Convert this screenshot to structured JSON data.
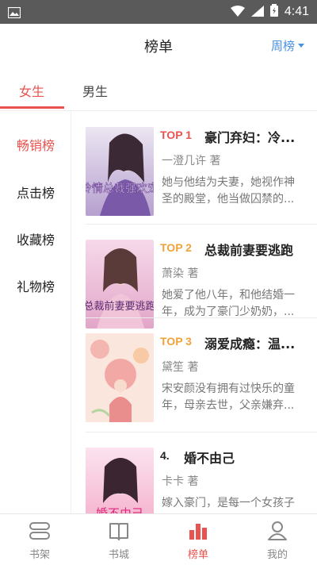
{
  "status_bar": {
    "time": "4:41"
  },
  "header": {
    "title": "榜单",
    "period_selector": "周榜"
  },
  "gender_tabs": [
    {
      "label": "女生",
      "active": true
    },
    {
      "label": "男生",
      "active": false
    }
  ],
  "sidebar": {
    "items": [
      {
        "label": "畅销榜",
        "active": true
      },
      {
        "label": "点击榜",
        "active": false
      },
      {
        "label": "收藏榜",
        "active": false
      },
      {
        "label": "礼物榜",
        "active": false
      }
    ]
  },
  "books": [
    {
      "rank": "TOP 1",
      "title": "豪门弃妇：冷...",
      "author": "一澄几许 著",
      "description": "她与他结为夫妻，她视作神圣的殿堂，他当做囚禁的...",
      "cover_text": "冷情总裁强欢宠"
    },
    {
      "rank": "TOP 2",
      "title": "总裁前妻要逃跑",
      "author": "萧染 著",
      "description": "她爱了他八年，和他结婚一年，成为了豪门少奶奶，...",
      "cover_text": "总裁前妻要逃跑"
    },
    {
      "rank": "TOP 3",
      "title": "溺爱成瘾：温...",
      "author": "黛笙 著",
      "description": "宋安颜没有拥有过快乐的童年，母亲去世，父亲嫌弃...",
      "cover_text": ""
    },
    {
      "rank": "4.",
      "title": "婚不由己",
      "author": "卡卡 著",
      "description": "嫁入豪门，是每一个女孩子的梦想，而对于...",
      "cover_text": "婚不由己"
    }
  ],
  "bottom_nav": [
    {
      "label": "书架",
      "icon": "bookshelf-icon",
      "active": false
    },
    {
      "label": "书城",
      "icon": "book-store-icon",
      "active": false
    },
    {
      "label": "榜单",
      "icon": "ranking-icon",
      "active": true
    },
    {
      "label": "我的",
      "icon": "profile-icon",
      "active": false
    }
  ],
  "colors": {
    "accent": "#e8534f",
    "link_blue": "#4a90e2",
    "top_gold": "#f0a23a"
  }
}
